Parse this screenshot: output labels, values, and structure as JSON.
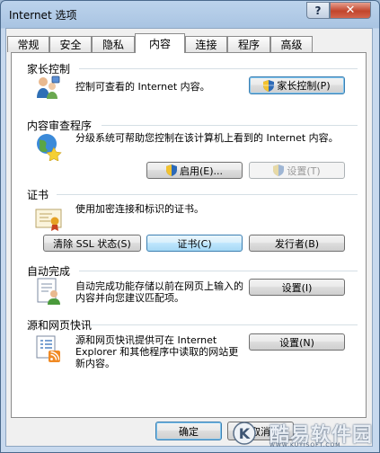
{
  "window": {
    "title": "Internet 选项",
    "help": "?",
    "close": "✕"
  },
  "tabs": [
    "常规",
    "安全",
    "隐私",
    "内容",
    "连接",
    "程序",
    "高级"
  ],
  "active_tab": "内容",
  "sections": {
    "parental": {
      "title": "家长控制",
      "desc": "控制可查看的 Internet 内容。",
      "button": "家长控制(P)"
    },
    "advisor": {
      "title": "内容审查程序",
      "desc": "分级系统可帮助您控制在该计算机上看到的 Internet 内容。",
      "enable_button": "启用(E)...",
      "settings_button": "设置(T)"
    },
    "certificates": {
      "title": "证书",
      "desc": "使用加密连接和标识的证书。",
      "clear_ssl_button": "清除 SSL 状态(S)",
      "certificates_button": "证书(C)",
      "publishers_button": "发行者(B)"
    },
    "autocomplete": {
      "title": "自动完成",
      "desc": "自动完成功能存储以前在网页上输入的内容并向您建议匹配项。",
      "button": "设置(I)"
    },
    "feeds": {
      "title": "源和网页快讯",
      "desc": "源和网页快讯提供可在 Internet Explorer 和其他程序中读取的网站更新内容。",
      "button": "设置(N)"
    }
  },
  "footer": {
    "ok_button": "确定",
    "cancel_button": "取消"
  },
  "watermark": {
    "logo": "K",
    "text": "酷易软件园",
    "sub": "WWW.KUYISOFT.COM"
  }
}
